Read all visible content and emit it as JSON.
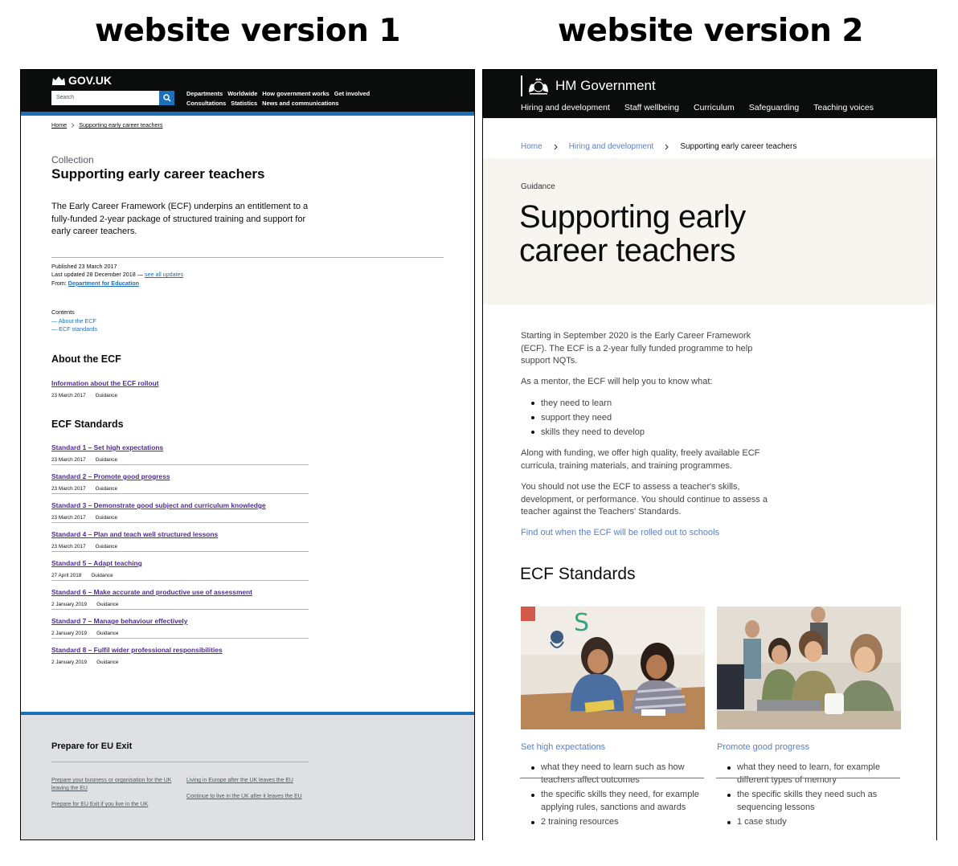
{
  "captions": {
    "v1": "website version 1",
    "v2": "website version 2"
  },
  "v1": {
    "logo": "GOV.UK",
    "search_placeholder": "Search",
    "nav_row1": [
      "Departments",
      "Worldwide",
      "How government works",
      "Get involved"
    ],
    "nav_row2": [
      "Consultations",
      "Statistics",
      "News and communications"
    ],
    "breadcrumb": [
      "Home",
      "Supporting early career teachers"
    ],
    "caption": "Collection",
    "title": "Supporting early career teachers",
    "lead": "The Early Career Framework (ECF) underpins an entitlement to a fully-funded 2-year package of structured training and support for early career teachers.",
    "meta": {
      "published": "Published 23 March 2017",
      "updated": "Last updated 28 December 2018 —",
      "see_all": "see all updates",
      "from_label": "From:",
      "from_org": "Department for Education"
    },
    "contents": {
      "heading": "Contents",
      "items": [
        "— About the ECF",
        "— ECF standards"
      ]
    },
    "about": {
      "heading": "About the ECF",
      "doc": {
        "title": "Information about the ECF rollout",
        "date": "23 March 2017",
        "type": "Guidance"
      }
    },
    "standards": {
      "heading": "ECF Standards",
      "docs": [
        {
          "title": "Standard 1 – Set high expectations",
          "date": "23 March 2017",
          "type": "Guidance"
        },
        {
          "title": "Standard 2 – Promote good progress",
          "date": "23 March 2017",
          "type": "Guidance"
        },
        {
          "title": "Standard 3 – Demonstrate good subject and curriculum knowledge",
          "date": "23 March 2017",
          "type": "Guidance"
        },
        {
          "title": "Standard 4 – Plan and teach well structured lessons",
          "date": "23 March 2017",
          "type": "Guidance"
        },
        {
          "title": "Standard 5 – Adapt teaching",
          "date": "27 April 2018",
          "type": "Guidance"
        },
        {
          "title": "Standard 6 – Make accurate and productive use of assessment",
          "date": "2 January 2019",
          "type": "Guidance"
        },
        {
          "title": "Standard 7 – Manage behaviour effectively",
          "date": "2 January 2019",
          "type": "Guidance"
        },
        {
          "title": "Standard 8 – Fulfil wider professional responsibilities",
          "date": "2 January 2019",
          "type": "Guidance"
        }
      ]
    },
    "footer": {
      "title": "Prepare for EU Exit",
      "links": [
        "Prepare your business or organisation for the UK leaving the EU",
        "Living in Europe after the UK leaves the EU",
        "Prepare for EU Exit if you live in the UK",
        "Continue to live in the UK after it leaves the EU"
      ]
    }
  },
  "v2": {
    "logo": "HM Government",
    "nav": [
      "Hiring and development",
      "Staff wellbeing",
      "Curriculum",
      "Safeguarding",
      "Teaching voices"
    ],
    "breadcrumb": [
      "Home",
      "Hiring and development",
      "Supporting early career teachers"
    ],
    "kicker": "Guidance",
    "title": "Supporting early career teachers",
    "intro": "Starting in September 2020 is the Early Career Framework (ECF). The ECF is a 2-year fully funded programme to help support NQTs.",
    "mentor": "As a mentor, the ECF will help you to know what:",
    "mentor_list": [
      "they need to learn",
      "support they need",
      "skills they need to develop"
    ],
    "funding": "Along with funding, we offer high quality, freely available ECF curricula, training materials, and training programmes.",
    "assess": "You should not use the ECF to assess a teacher's skills, development, or performance. You should continue to assess a teacher against the Teachers' Standards.",
    "rollout_link": "Find out when the ECF will be rolled out to schools",
    "standards_heading": "ECF Standards",
    "cards": [
      {
        "title": "Set high expectations",
        "items": [
          "what they need to learn such as how teachers affect outcomes",
          "the specific skills they need, for example applying rules, sanctions and awards",
          "2 training resources"
        ]
      },
      {
        "title": "Promote good progress",
        "items": [
          "what they need to learn, for example different types of memory",
          "the specific skills they need such as sequencing lessons",
          "1 case study"
        ]
      }
    ]
  },
  "colors": {
    "govuk_blue": "#1d70b8",
    "visited_purple": "#4c2c92",
    "header_black": "#0b0c0c",
    "hero_cream": "#f8f5f1",
    "v2_link": "#5a7fc4"
  }
}
